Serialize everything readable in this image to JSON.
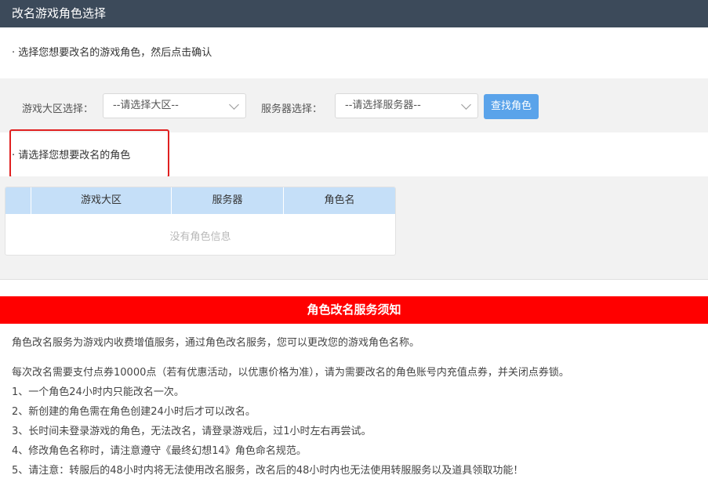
{
  "header": {
    "title": "改名游戏角色选择"
  },
  "step1": {
    "text": "· 选择您想要改名的游戏角色，然后点击确认"
  },
  "filters": {
    "region_label": "游戏大区选择：",
    "region_value": "--请选择大区--",
    "server_label": "服务器选择：",
    "server_value": "--请选择服务器--",
    "search_button": "查找角色"
  },
  "step2": {
    "text": "· 请选择您想要改名的角色"
  },
  "table": {
    "columns": [
      "游戏大区",
      "服务器",
      "角色名"
    ],
    "empty_text": "没有角色信息"
  },
  "notice": {
    "title": "角色改名服务须知",
    "intro": "角色改名服务为游戏内收费增值服务，通过角色改名服务，您可以更改您的游戏角色名称。",
    "fee": "每次改名需要支付点券10000点（若有优惠活动，以优惠价格为准），请为需要改名的角色账号内充值点券，并关闭点券锁。",
    "rules": [
      "1、一个角色24小时内只能改名一次。",
      "2、新创建的角色需在角色创建24小时后才可以改名。",
      "3、长时间未登录游戏的角色，无法改名，请登录游戏后，过1小时左右再尝试。",
      "4、修改角色名称时，请注意遵守《最终幻想14》角色命名规范。",
      "5、请注意：转服后的48小时内将无法使用改名服务，改名后的48小时内也无法使用转服服务以及道具领取功能！"
    ]
  },
  "colors": {
    "titlebar": "#3c4a5a",
    "button": "#5aa3ea",
    "table_header": "#c5dff8",
    "notice_bar": "#ff0000",
    "highlight_box": "#e02020"
  }
}
